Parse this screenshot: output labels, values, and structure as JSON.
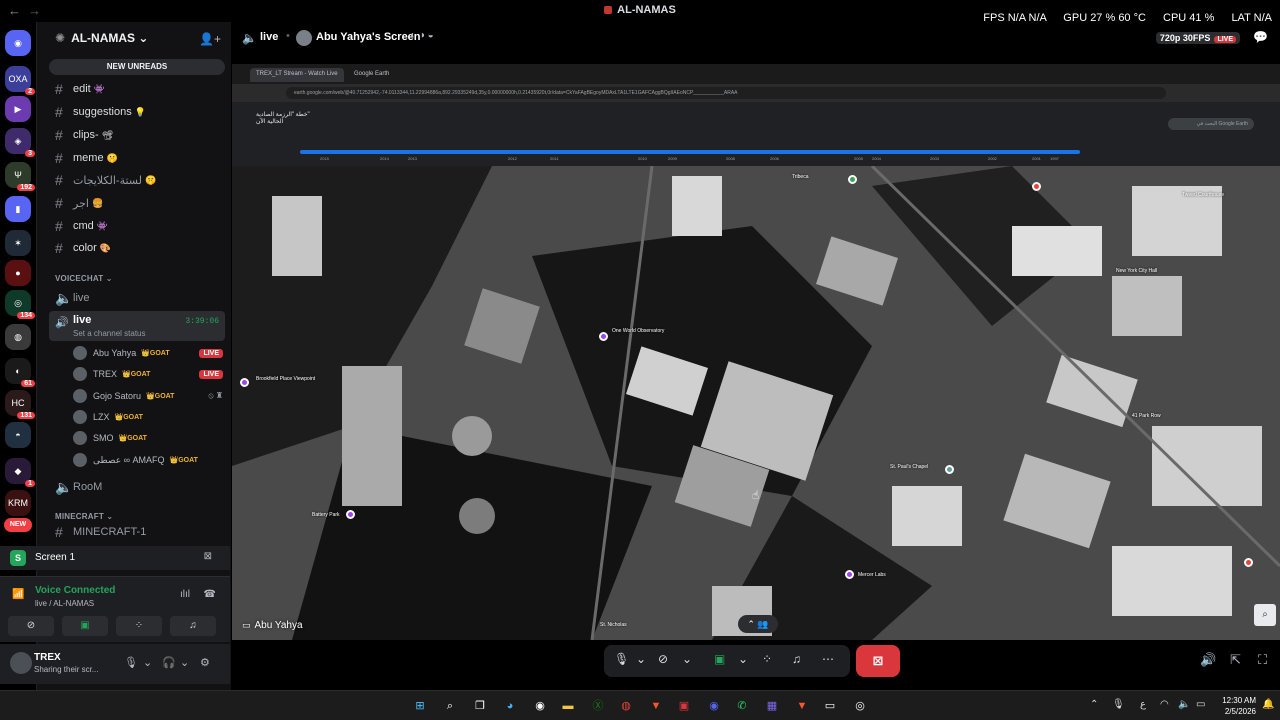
{
  "window": {
    "title": "AL-NAMAS",
    "stats": {
      "fps": "FPS N/A N/A",
      "gpu": "GPU 27 % 60 °C",
      "cpu": "CPU 41 %",
      "lat": "LAT N/A"
    }
  },
  "server": {
    "name": "AL-NAMAS",
    "new_unreads": "NEW UNREADS"
  },
  "rail": {
    "badges": [
      "2",
      "3",
      "192",
      "134",
      "61",
      "131",
      "1"
    ],
    "new_label": "NEW"
  },
  "channels": [
    {
      "name": "edit",
      "emoji": "👾"
    },
    {
      "name": "suggestions",
      "emoji": "💡"
    },
    {
      "name": "clips-",
      "emoji": "📽"
    },
    {
      "name": "meme",
      "emoji": "🤫"
    },
    {
      "name": "لستة-الكلايجات",
      "emoji": "🤫"
    },
    {
      "name": "اجر",
      "emoji": "🍔"
    },
    {
      "name": "cmd",
      "emoji": "👾"
    },
    {
      "name": "color",
      "emoji": "🎨"
    }
  ],
  "voice_category": "VOICECHAT",
  "active_voice": {
    "name": "live",
    "status": "Set a channel status",
    "time": "3:39:06"
  },
  "voice_users": [
    {
      "name": "Abu Yahya",
      "tag": "GOAT",
      "live": "LIVE"
    },
    {
      "name": "TREX",
      "tag": "GOAT",
      "live": "LIVE"
    },
    {
      "name": "Gojo Satoru",
      "tag": "GOAT",
      "live": ""
    },
    {
      "name": "LZX",
      "tag": "GOAT",
      "live": ""
    },
    {
      "name": "SMO",
      "tag": "GOAT",
      "live": ""
    },
    {
      "name": "عصطى ∞ AMAFQ",
      "tag": "GOAT",
      "live": ""
    }
  ],
  "room_channel": "RooM",
  "minecraft_category": "MINECRAFT",
  "minecraft_channel": "MINECRAFT-1",
  "screen_panel": {
    "label": "Screen 1"
  },
  "voice_panel": {
    "connected": "Voice Connected",
    "location": "live / AL-NAMAS"
  },
  "user": {
    "name": "TREX",
    "status": "Sharing their scr..."
  },
  "stream": {
    "channel": "live",
    "title": "Abu Yahya's Screen",
    "quality": "720p 30FPS",
    "live": "LIVE",
    "streamer": "Abu Yahya"
  },
  "browser": {
    "tabs": [
      "TREX_LT Stream - Watch Live",
      "Google Earth"
    ],
    "url": "earth.google.com/web/@40.71252942,-74.0113344,11.22994886a,892.29335249d,35y,0.00000000h,0.21435920t,0r/data=CkYaFAgBEgoyMDAxLTA1LTE1GAFCAggBQgIIAEoNCP___________ARAA",
    "project": "خطة \"الرزمة الصادية\"",
    "project_sub": "الحالية الآن",
    "search": "البحث في Google Earth",
    "timeline_years": [
      "2015",
      "2014",
      "2013",
      "2012",
      "2011",
      "2010",
      "2009",
      "2008",
      "2006",
      "2005",
      "2004",
      "2003",
      "2002",
      "2001",
      "1997"
    ]
  },
  "map_labels": [
    "Tribeca",
    "Tweed Courthouse",
    "One World Observatory",
    "New York City Hall",
    "Brookfield Place Viewpoint",
    "St. Paul's Chapel",
    "41 Park Row",
    "Mercer Labs",
    "St. Nicholas",
    "Battery Park"
  ],
  "taskbar": {
    "time": "12:30 AM",
    "date": "2/5/2026"
  }
}
